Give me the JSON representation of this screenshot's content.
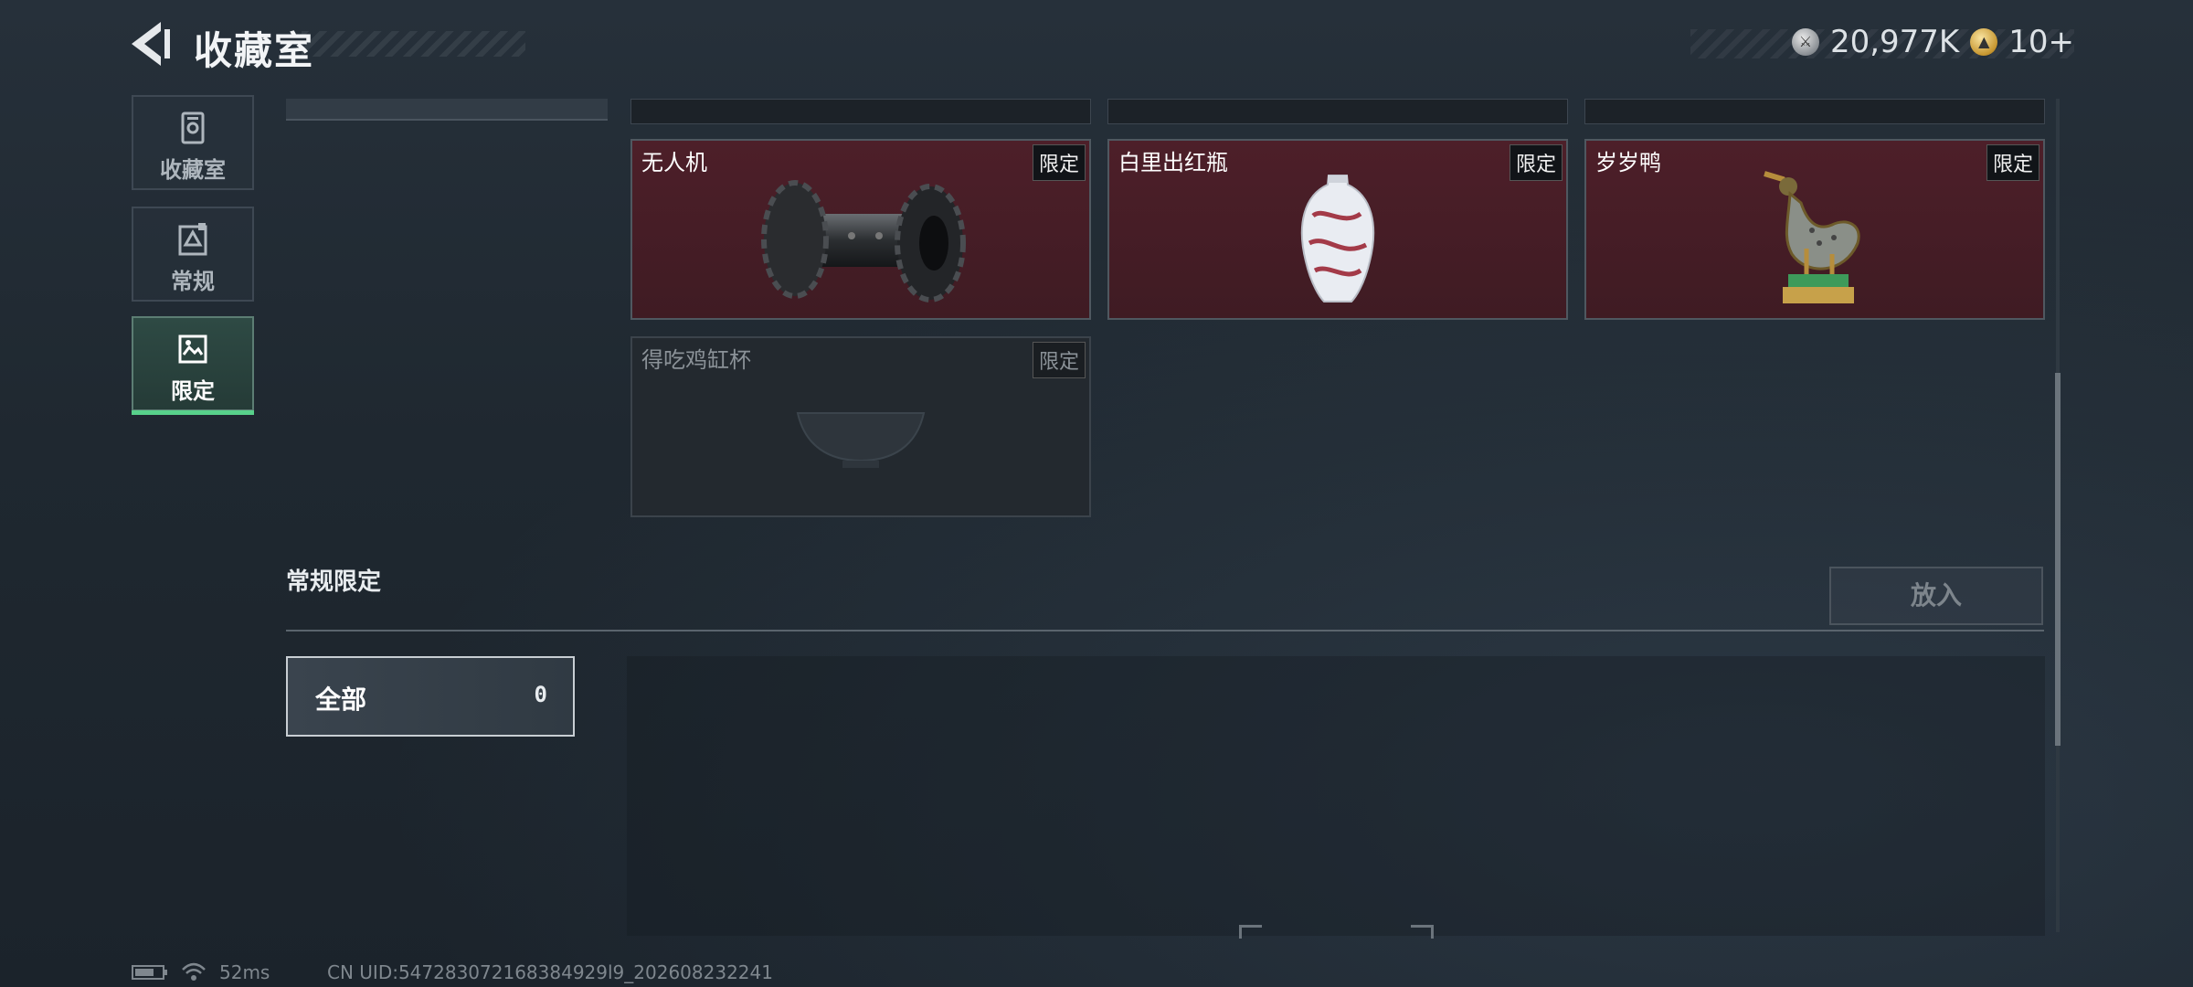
{
  "header": {
    "title": "收藏室",
    "currency_silver": "20,977K",
    "currency_gold": "10+"
  },
  "sidebar": {
    "items": [
      {
        "label": "收藏室",
        "icon": "collection-icon",
        "active": false
      },
      {
        "label": "常规",
        "icon": "regular-icon",
        "active": false
      },
      {
        "label": "限定",
        "icon": "limited-icon",
        "active": true
      }
    ]
  },
  "grid": {
    "items": [
      {
        "name": "无人机",
        "badge": "限定",
        "icon": "drone-roller-icon",
        "owned": true
      },
      {
        "name": "白里出红瓶",
        "badge": "限定",
        "icon": "porcelain-vase-icon",
        "owned": true
      },
      {
        "name": "岁岁鸭",
        "badge": "限定",
        "icon": "bronze-duck-icon",
        "owned": true
      },
      {
        "name": "得吃鸡缸杯",
        "badge": "限定",
        "icon": "bowl-icon",
        "owned": false
      }
    ]
  },
  "section": {
    "title": "常规限定",
    "put_in_label": "放入",
    "filter_label": "全部",
    "filter_count": "0"
  },
  "footer": {
    "ping": "52ms",
    "uid": "CN UID:547283072168384929l9_202608232241"
  },
  "colors": {
    "accent_green": "#58d18b",
    "card_owned_bg": "#4d1f29",
    "background": "#222b33"
  }
}
